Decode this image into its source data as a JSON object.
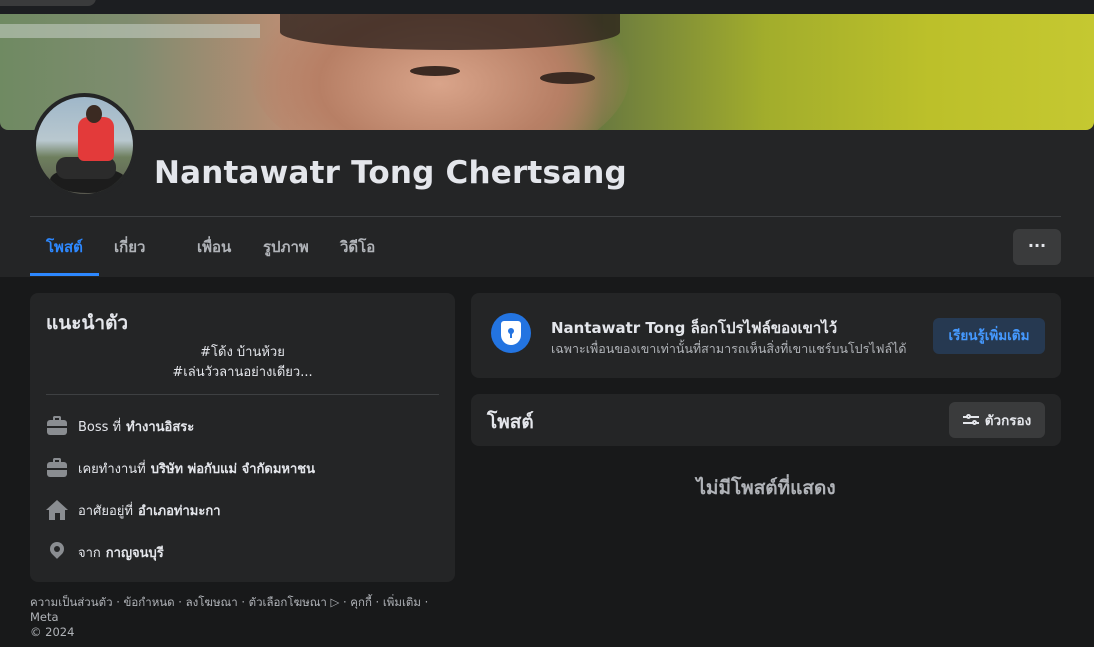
{
  "profile": {
    "name": "Nantawatr Tong Chertsang"
  },
  "tabs": [
    {
      "label": "โพสต์",
      "active": true
    },
    {
      "label": "เกี่ยวกับ"
    },
    {
      "label": "เพื่อน"
    },
    {
      "label": "รูปภาพ"
    },
    {
      "label": "วิดีโอ"
    }
  ],
  "more_button": "···",
  "intro": {
    "title": "แนะนำตัว",
    "bio_line1": "#โด้ง บ้านห้วย",
    "bio_line2": "#เล่นวัวลานอย่างเดียว...",
    "rows": [
      {
        "icon": "briefcase-icon",
        "prefix": "Boss ที่",
        "value": "ทำงานอิสระ"
      },
      {
        "icon": "briefcase-icon",
        "prefix": "เคยทำงานที่",
        "value": "บริษัท พ่อกับแม่ จำกัดมหาชน"
      },
      {
        "icon": "home-icon",
        "prefix": "อาศัยอยู่ที่",
        "value": "อำเภอท่ามะกา"
      },
      {
        "icon": "location-pin-icon",
        "prefix": "จาก",
        "value": "กาญจนบุรี"
      }
    ]
  },
  "footer": {
    "line1": "ความเป็นส่วนตัว · ข้อกำหนด · ลงโฆษณา · ตัวเลือกโฆษณา ▷ · คุกกี้ · เพิ่มเติม · Meta",
    "line2": "© 2024"
  },
  "locked_notice": {
    "title": "Nantawatr Tong ล็อกโปรไฟล์ของเขาไว้",
    "subtitle": "เฉพาะเพื่อนของเขาเท่านั้นที่สามารถเห็นสิ่งที่เขาแชร์บนโปรไฟล์ได้",
    "button": "เรียนรู้เพิ่มเติม"
  },
  "posts": {
    "title": "โพสต์",
    "filter_button": "ตัวกรอง",
    "empty_text": "ไม่มีโพสต์ที่แสดง"
  },
  "colors": {
    "accent": "#2d88ff",
    "background": "#18191a",
    "card": "#242526"
  }
}
